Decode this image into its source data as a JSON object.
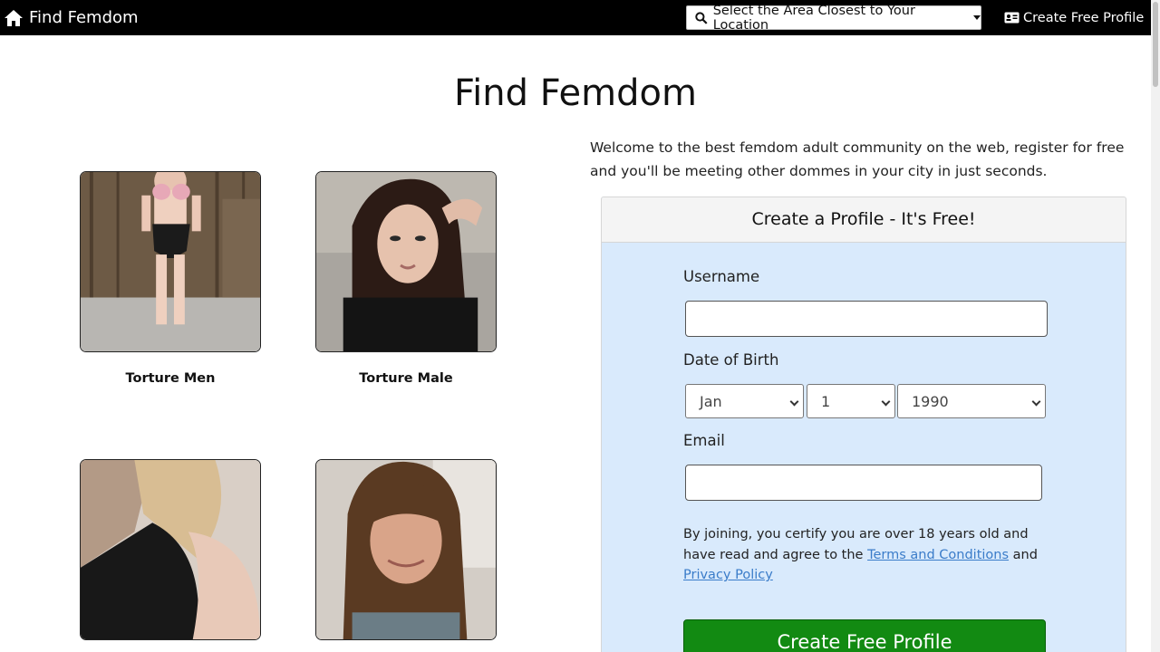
{
  "nav": {
    "brand": "Find Femdom",
    "location_button": "Select the Area Closest to Your Location",
    "create_link": "Create Free Profile"
  },
  "page_title": "Find Femdom",
  "profiles": [
    {
      "name": "Torture Men"
    },
    {
      "name": "Torture Male"
    },
    {
      "name": ""
    },
    {
      "name": ""
    }
  ],
  "welcome_text": "Welcome to the best femdom adult community on the web, register for free and you'll be meeting other dommes in your city in just seconds.",
  "signup": {
    "header": "Create a Profile - It's Free!",
    "username_label": "Username",
    "username_value": "",
    "dob_label": "Date of Birth",
    "dob_month": "Jan",
    "dob_day": "1",
    "dob_year": "1990",
    "email_label": "Email",
    "email_value": "",
    "terms_prefix": "By joining, you certify you are over 18 years old and have read and agree to the",
    "terms_link": "Terms and Conditions",
    "terms_and": "and",
    "privacy_link": "Privacy Policy",
    "submit": "Create Free Profile"
  },
  "colors": {
    "navbar": "#000000",
    "panel_bg": "#d9eafc",
    "submit_bg": "#128a12",
    "link": "#3a7cc9"
  }
}
